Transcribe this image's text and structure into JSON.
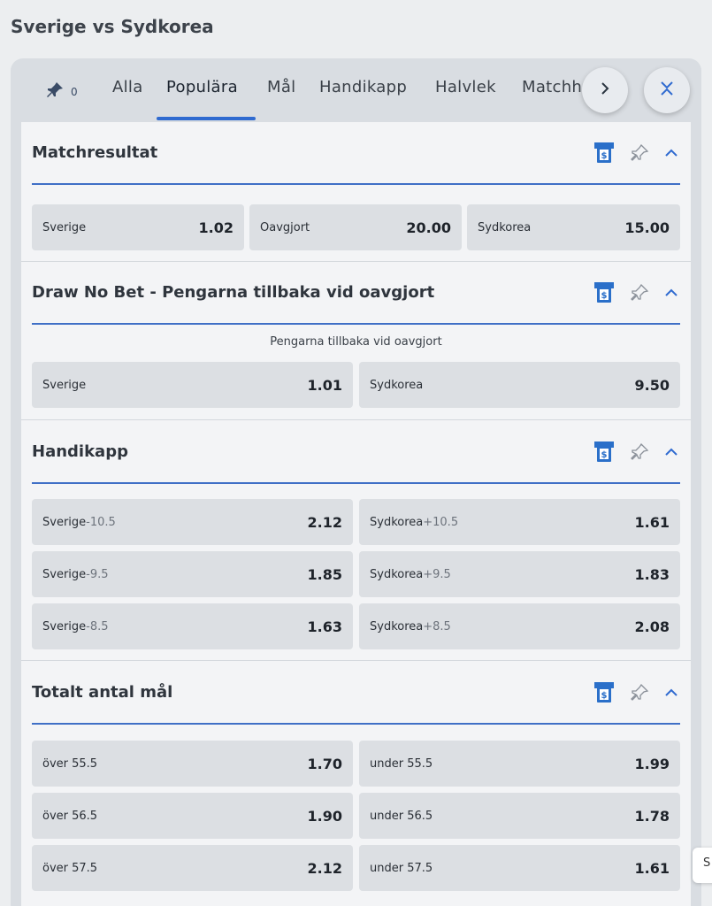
{
  "page": {
    "title": "Sverige vs Sydkorea"
  },
  "tabs": {
    "pin_count": "0",
    "items": [
      {
        "label": "Alla"
      },
      {
        "label": "Populära",
        "active": true
      },
      {
        "label": "Mål"
      },
      {
        "label": "Handikapp"
      },
      {
        "label": "Halvlek"
      },
      {
        "label": "Matchh"
      }
    ]
  },
  "sections": [
    {
      "title": "Matchresultat",
      "outcomes": [
        {
          "label": "Sverige",
          "line": "",
          "price": "1.02"
        },
        {
          "label": "Oavgjort",
          "line": "",
          "price": "20.00"
        },
        {
          "label": "Sydkorea",
          "line": "",
          "price": "15.00"
        }
      ]
    },
    {
      "title": "Draw No Bet - Pengarna tillbaka vid oavgjort",
      "subtitle": "Pengarna tillbaka vid oavgjort",
      "outcomes": [
        {
          "label": "Sverige",
          "line": "",
          "price": "1.01"
        },
        {
          "label": "Sydkorea",
          "line": "",
          "price": "9.50"
        }
      ]
    },
    {
      "title": "Handikapp",
      "outcomes": [
        {
          "label": "Sverige",
          "line": "-10.5",
          "price": "2.12"
        },
        {
          "label": "Sydkorea",
          "line": "+10.5",
          "price": "1.61"
        },
        {
          "label": "Sverige",
          "line": "-9.5",
          "price": "1.85"
        },
        {
          "label": "Sydkorea",
          "line": "+9.5",
          "price": "1.83"
        },
        {
          "label": "Sverige",
          "line": "-8.5",
          "price": "1.63"
        },
        {
          "label": "Sydkorea",
          "line": "+8.5",
          "price": "2.08"
        }
      ]
    },
    {
      "title": "Totalt antal mål",
      "outcomes": [
        {
          "label": "över 55.5",
          "line": "",
          "price": "1.70"
        },
        {
          "label": "under 55.5",
          "line": "",
          "price": "1.99"
        },
        {
          "label": "över 56.5",
          "line": "",
          "price": "1.90"
        },
        {
          "label": "under 56.5",
          "line": "",
          "price": "1.78"
        },
        {
          "label": "över 57.5",
          "line": "",
          "price": "2.12"
        },
        {
          "label": "under 57.5",
          "line": "",
          "price": "1.61"
        }
      ]
    }
  ],
  "edge_tab": {
    "label": "S"
  },
  "colors": {
    "accent": "#2f6ad0",
    "bet_builder_icon": "#2a6fc9"
  }
}
